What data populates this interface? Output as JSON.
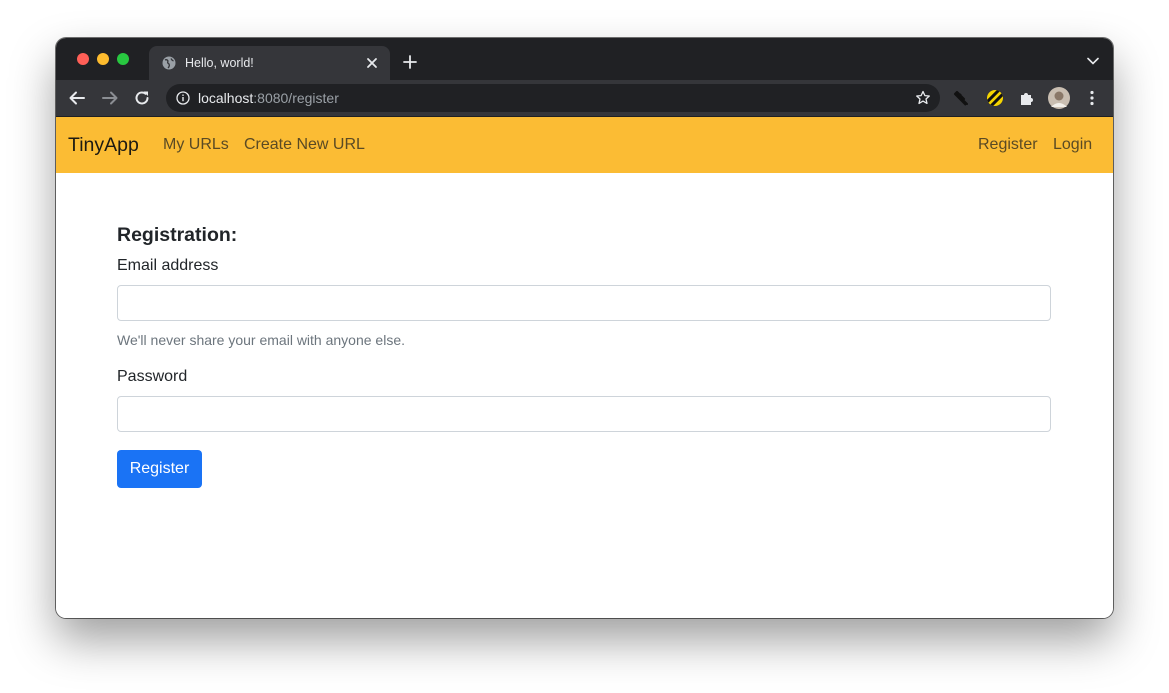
{
  "browser": {
    "tab": {
      "title": "Hello, world!"
    },
    "address_bar": {
      "host": "localhost",
      "rest": ":8080/register"
    }
  },
  "navbar": {
    "brand": "TinyApp",
    "left_links": [
      "My URLs",
      "Create New URL"
    ],
    "right_links": [
      "Register",
      "Login"
    ],
    "background_color": "#fbbc34"
  },
  "form": {
    "title": "Registration:",
    "email": {
      "label": "Email address",
      "value": "",
      "help_text": "We'll never share your email with anyone else."
    },
    "password": {
      "label": "Password",
      "value": ""
    },
    "submit_label": "Register",
    "submit_color": "#1a73f5"
  },
  "icons": {
    "tab": [
      "globe-icon",
      "close-icon",
      "new-tab-icon",
      "tab-list-chevron-icon"
    ],
    "toolbar": [
      "back-arrow-icon",
      "forward-arrow-icon",
      "reload-icon",
      "site-info-icon",
      "bookmark-star-icon",
      "pin-extension-icon",
      "striped-extension-icon",
      "puzzle-extensions-icon",
      "profile-avatar-icon",
      "kebab-menu-icon"
    ]
  }
}
